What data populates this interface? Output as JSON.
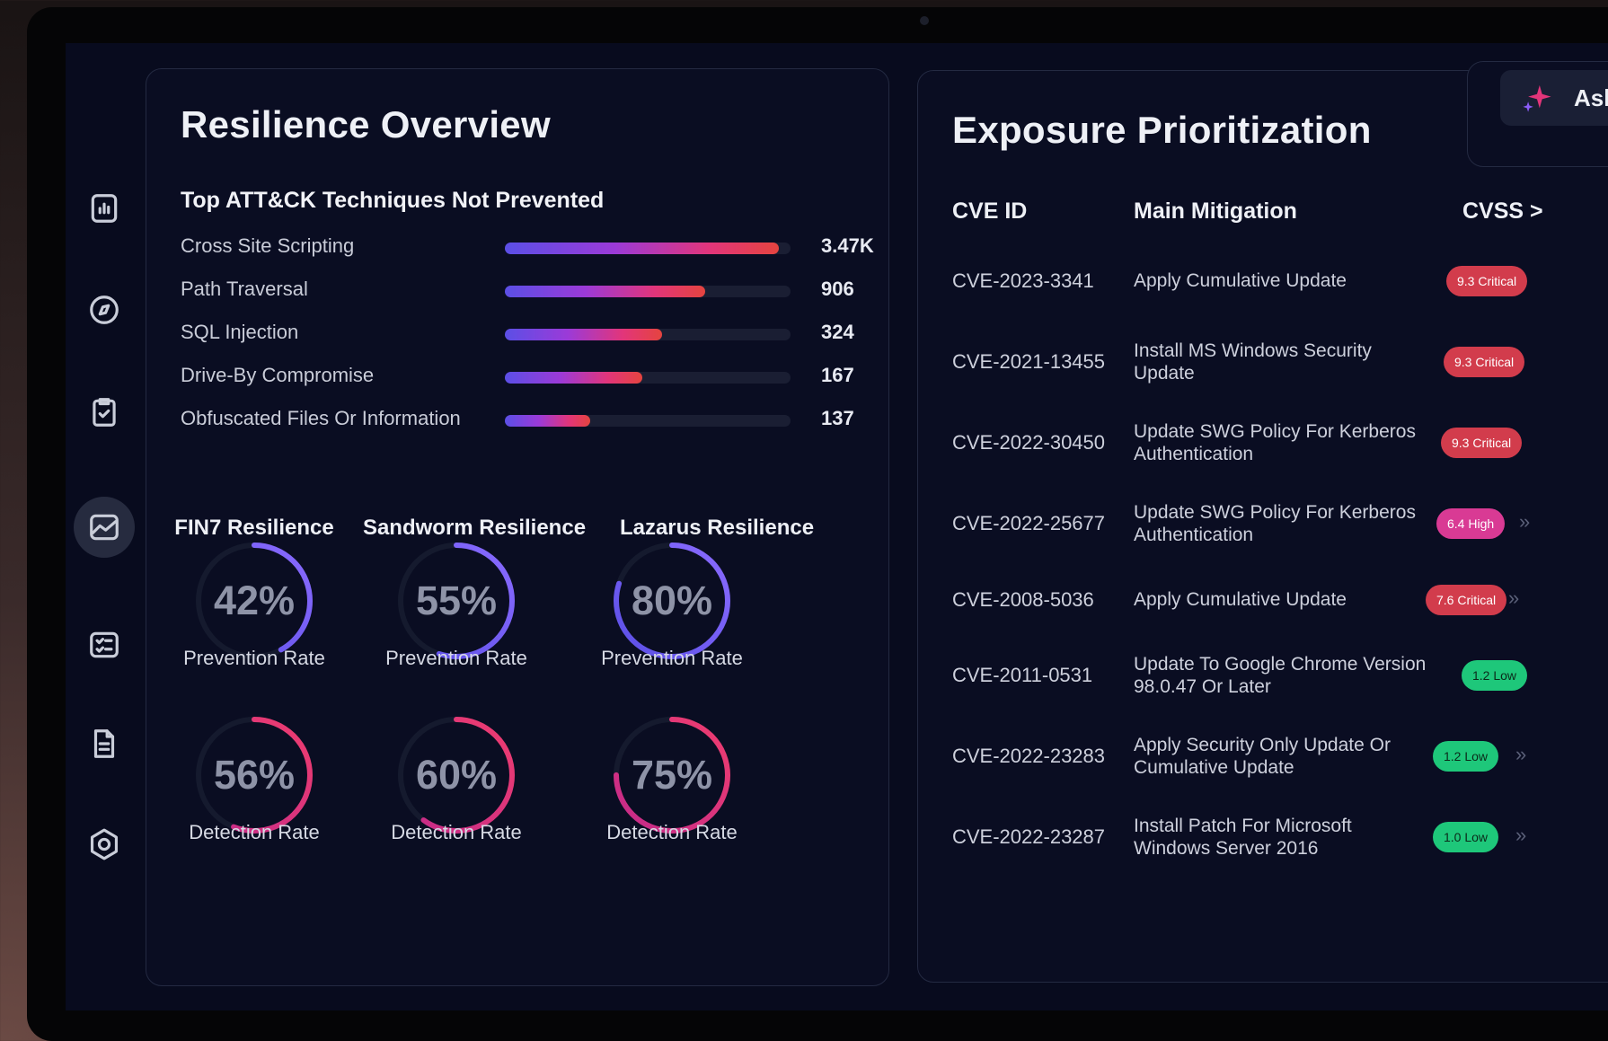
{
  "sidebar": {
    "icons": [
      "bar-chart-icon",
      "compass-icon",
      "clipboard-check-icon",
      "trend-chart-icon",
      "checklist-icon",
      "document-icon",
      "settings-icon"
    ],
    "active": "trend-chart-icon"
  },
  "resilience": {
    "title": "Resilience Overview",
    "techniques_title": "Top ATT&CK Techniques Not Prevented",
    "techniques": [
      {
        "label": "Cross Site Scripting",
        "value": "3.47K",
        "fraction": 0.96
      },
      {
        "label": "Path Traversal",
        "value": "906",
        "fraction": 0.7
      },
      {
        "label": "SQL Injection",
        "value": "324",
        "fraction": 0.55
      },
      {
        "label": "Drive-By Compromise",
        "value": "167",
        "fraction": 0.48
      },
      {
        "label": "Obfuscated Files Or Information",
        "value": "137",
        "fraction": 0.3
      }
    ],
    "groups": [
      {
        "name": "FIN7 Resilience",
        "prevention": "42%",
        "prevention_value": 42,
        "detection": "56%",
        "detection_value": 56
      },
      {
        "name": "Sandworm Resilience",
        "prevention": "55%",
        "prevention_value": 55,
        "detection": "60%",
        "detection_value": 60
      },
      {
        "name": "Lazarus Resilience",
        "prevention": "80%",
        "prevention_value": 80,
        "detection": "75%",
        "detection_value": 75
      }
    ],
    "prevention_label": "Prevention Rate",
    "detection_label": "Detection Rate"
  },
  "exposure": {
    "title": "Exposure Prioritization",
    "columns": [
      "CVE ID",
      "Main Mitigation",
      "CVSS >"
    ],
    "rows": [
      {
        "cve": "CVE-2023-3341",
        "mitigation": "Apply Cumulative Update",
        "cvss": "9.3 Critical",
        "severity": "critical"
      },
      {
        "cve": "CVE-2021-13455",
        "mitigation": "Install MS Windows Security Update",
        "cvss": "9.3 Critical",
        "severity": "critical"
      },
      {
        "cve": "CVE-2022-30450",
        "mitigation": "Update SWG Policy For Kerberos Authentication",
        "cvss": "9.3 Critical",
        "severity": "critical"
      },
      {
        "cve": "CVE-2022-25677",
        "mitigation": "Update SWG Policy For Kerberos Authentication",
        "cvss": "6.4 High",
        "severity": "high"
      },
      {
        "cve": "CVE-2008-5036",
        "mitigation": "Apply Cumulative Update",
        "cvss": "7.6 Critical",
        "severity": "critical"
      },
      {
        "cve": "CVE-2011-0531",
        "mitigation": "Update To Google Chrome Version 98.0.47 Or Later",
        "cvss": "1.2 Low",
        "severity": "low"
      },
      {
        "cve": "CVE-2022-23283",
        "mitigation": "Apply Security Only Update Or Cumulative Update",
        "cvss": "1.2 Low",
        "severity": "low"
      },
      {
        "cve": "CVE-2022-23287",
        "mitigation": "Install Patch For Microsoft Windows Server 2016",
        "cvss": "1.0 Low",
        "severity": "low"
      }
    ]
  },
  "ask": {
    "label": "Ask"
  },
  "colors": {
    "prevention": "#6b5cf0",
    "detection": "#e0357f",
    "critical": "#d23c4c",
    "high": "#d93a94",
    "low": "#1ec77a"
  }
}
